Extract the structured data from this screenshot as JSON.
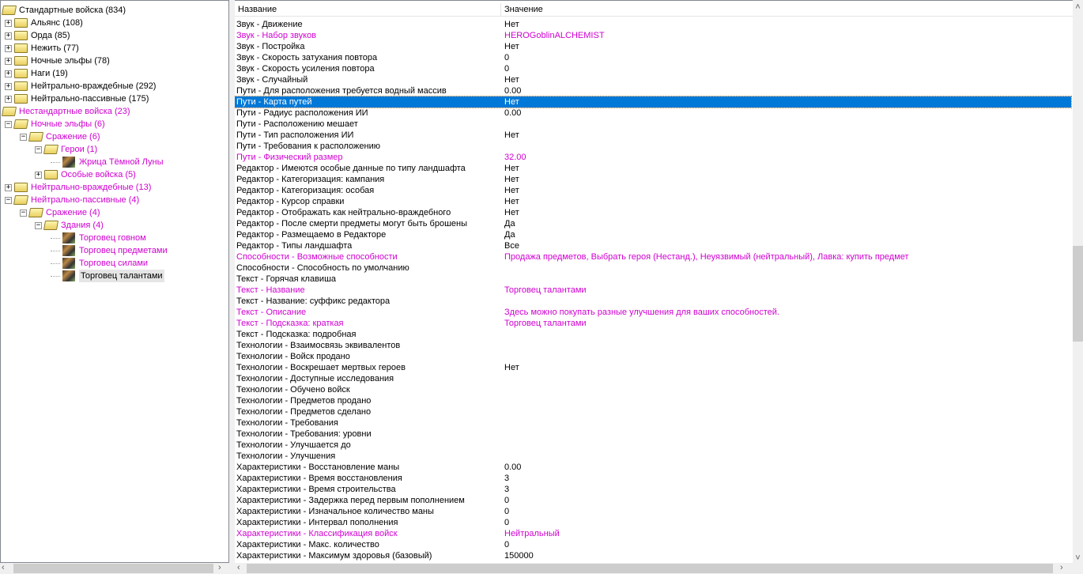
{
  "tree": [
    {
      "label": "Стандартные войска (834)",
      "level": 0,
      "kind": "open",
      "magenta": false
    },
    {
      "label": "Альянс (108)",
      "level": 1,
      "kind": "closed",
      "exp": "+",
      "magenta": false
    },
    {
      "label": "Орда (85)",
      "level": 1,
      "kind": "closed",
      "exp": "+",
      "magenta": false
    },
    {
      "label": "Нежить (77)",
      "level": 1,
      "kind": "closed",
      "exp": "+",
      "magenta": false
    },
    {
      "label": "Ночные эльфы (78)",
      "level": 1,
      "kind": "closed",
      "exp": "+",
      "magenta": false
    },
    {
      "label": "Наги (19)",
      "level": 1,
      "kind": "closed",
      "exp": "+",
      "magenta": false
    },
    {
      "label": "Нейтрально-враждебные (292)",
      "level": 1,
      "kind": "closed",
      "exp": "+",
      "magenta": false
    },
    {
      "label": "Нейтрально-пассивные (175)",
      "level": 1,
      "kind": "closed",
      "exp": "+",
      "magenta": false
    },
    {
      "label": "Нестандартные войска (23)",
      "level": 0,
      "kind": "open",
      "magenta": true
    },
    {
      "label": "Ночные эльфы (6)",
      "level": 1,
      "kind": "open",
      "exp": "−",
      "magenta": true
    },
    {
      "label": "Сражение (6)",
      "level": 2,
      "kind": "open",
      "exp": "−",
      "magenta": true
    },
    {
      "label": "Герои (1)",
      "level": 3,
      "kind": "open",
      "exp": "−",
      "magenta": true
    },
    {
      "label": "Жрица Тёмной Луны",
      "level": 4,
      "kind": "unit",
      "magenta": true
    },
    {
      "label": "Особые войска (5)",
      "level": 3,
      "kind": "closed",
      "exp": "+",
      "magenta": true
    },
    {
      "label": "Нейтрально-враждебные (13)",
      "level": 1,
      "kind": "closed",
      "exp": "+",
      "magenta": true
    },
    {
      "label": "Нейтрально-пассивные (4)",
      "level": 1,
      "kind": "open",
      "exp": "−",
      "magenta": true
    },
    {
      "label": "Сражение (4)",
      "level": 2,
      "kind": "open",
      "exp": "−",
      "magenta": true
    },
    {
      "label": "Здания (4)",
      "level": 3,
      "kind": "open",
      "exp": "−",
      "magenta": true
    },
    {
      "label": "Торговец говном",
      "level": 4,
      "kind": "unit",
      "magenta": true
    },
    {
      "label": "Торговец предметами",
      "level": 4,
      "kind": "unit",
      "magenta": true
    },
    {
      "label": "Торговец силами",
      "level": 4,
      "kind": "unit",
      "magenta": true
    },
    {
      "label": "Торговец талантами",
      "level": 4,
      "kind": "unit",
      "magenta": false,
      "selected": true
    }
  ],
  "columns": {
    "name": "Название",
    "value": "Значение"
  },
  "rows": [
    {
      "n": "Звук - Движение",
      "v": "Нет"
    },
    {
      "n": "Звук - Набор звуков",
      "v": "HEROGoblinALCHEMIST",
      "m": true
    },
    {
      "n": "Звук - Постройка",
      "v": "Нет"
    },
    {
      "n": "Звук - Скорость затухания повтора",
      "v": "0"
    },
    {
      "n": "Звук - Скорость усиления повтора",
      "v": "0"
    },
    {
      "n": "Звук - Случайный",
      "v": "Нет"
    },
    {
      "n": "Пути - Для расположения требуется водный массив",
      "v": "0.00"
    },
    {
      "n": "Пути - Карта путей",
      "v": "Нет",
      "sel": true
    },
    {
      "n": "Пути - Радиус расположения ИИ",
      "v": "0.00"
    },
    {
      "n": "Пути - Расположению мешает",
      "v": ""
    },
    {
      "n": "Пути - Тип расположения ИИ",
      "v": "Нет"
    },
    {
      "n": "Пути - Требования к расположению",
      "v": ""
    },
    {
      "n": "Пути - Физический размер",
      "v": "32.00",
      "m": true
    },
    {
      "n": "Редактор - Имеются особые данные по типу ландшафта",
      "v": "Нет"
    },
    {
      "n": "Редактор - Категоризация: кампания",
      "v": "Нет"
    },
    {
      "n": "Редактор - Категоризация: особая",
      "v": "Нет"
    },
    {
      "n": "Редактор - Курсор справки",
      "v": "Нет"
    },
    {
      "n": "Редактор - Отображать как нейтрально-враждебного",
      "v": "Нет"
    },
    {
      "n": "Редактор - После смерти предметы могут быть брошены",
      "v": "Да"
    },
    {
      "n": "Редактор - Размещаемо в Редакторе",
      "v": "Да"
    },
    {
      "n": "Редактор - Типы ландшафта",
      "v": "Все"
    },
    {
      "n": "Способности - Возможные способности",
      "v": "Продажа предметов, Выбрать героя (Нестанд.), Неуязвимый (нейтральный), Лавка: купить предмет",
      "m": true
    },
    {
      "n": "Способности - Способность по умолчанию",
      "v": ""
    },
    {
      "n": "Текст - Горячая клавиша",
      "v": ""
    },
    {
      "n": "Текст - Название",
      "v": "Торговец талантами",
      "m": true
    },
    {
      "n": "Текст - Название: суффикс редактора",
      "v": ""
    },
    {
      "n": "Текст - Описание",
      "v": "Здесь можно покупать разные улучшения для ваших способностей.",
      "m": true
    },
    {
      "n": "Текст - Подсказка: краткая",
      "v": "Торговец талантами",
      "m": true
    },
    {
      "n": "Текст - Подсказка: подробная",
      "v": ""
    },
    {
      "n": "Технологии - Взаимосвязь эквивалентов",
      "v": ""
    },
    {
      "n": "Технологии - Войск продано",
      "v": ""
    },
    {
      "n": "Технологии - Воскрешает мертвых героев",
      "v": "Нет"
    },
    {
      "n": "Технологии - Доступные исследования",
      "v": ""
    },
    {
      "n": "Технологии - Обучено войск",
      "v": ""
    },
    {
      "n": "Технологии - Предметов продано",
      "v": ""
    },
    {
      "n": "Технологии - Предметов сделано",
      "v": ""
    },
    {
      "n": "Технологии - Требования",
      "v": ""
    },
    {
      "n": "Технологии - Требования: уровни",
      "v": ""
    },
    {
      "n": "Технологии - Улучшается до",
      "v": ""
    },
    {
      "n": "Технологии - Улучшения",
      "v": ""
    },
    {
      "n": "Характеристики - Восстановление маны",
      "v": "0.00"
    },
    {
      "n": "Характеристики - Время восстановления",
      "v": "3"
    },
    {
      "n": "Характеристики - Время строительства",
      "v": "3"
    },
    {
      "n": "Характеристики - Задержка перед первым пополнением",
      "v": "0"
    },
    {
      "n": "Характеристики - Изначальное количество маны",
      "v": "0"
    },
    {
      "n": "Характеристики - Интервал пополнения",
      "v": "0"
    },
    {
      "n": "Характеристики - Классификация войск",
      "v": "Нейтральный",
      "m": true
    },
    {
      "n": "Характеристики - Макс. количество",
      "v": "0"
    },
    {
      "n": "Характеристики - Максимум здоровья (базовый)",
      "v": "150000"
    }
  ],
  "scroll": {
    "vertical_position_fraction": 0.6,
    "vertical_visible_fraction": 0.17
  },
  "colors": {
    "magenta": "#d000d0",
    "selection": "#0078d7"
  }
}
